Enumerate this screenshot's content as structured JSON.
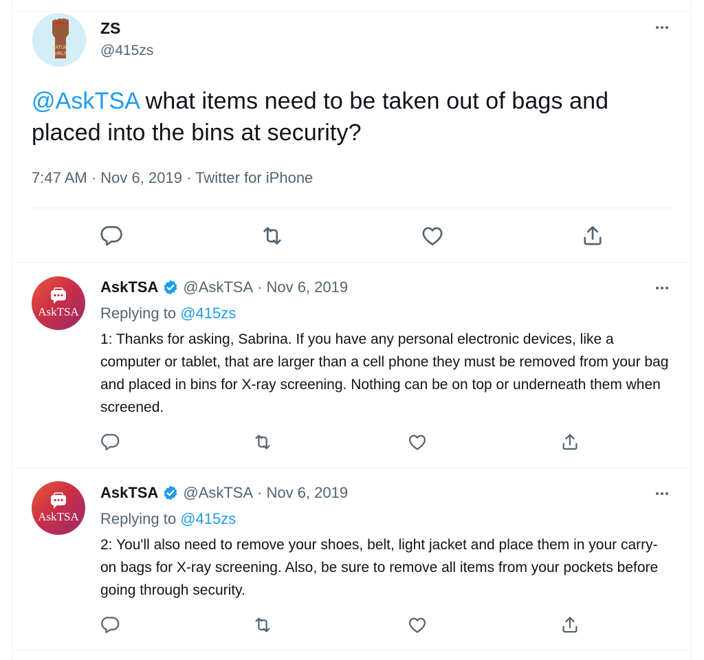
{
  "main_tweet": {
    "display_name": "ZS",
    "handle": "@415zs",
    "mention": "@AskTSA",
    "text": " what items need to be taken out of bags and placed into the bins at security?",
    "time": "7:47 AM",
    "separator": "·",
    "date": "Nov 6, 2019",
    "source": "Twitter for iPhone",
    "avatar_icon": "raised-fist-avatar"
  },
  "replies": [
    {
      "display_name": "AskTSA",
      "verified_icon": "verified-badge-icon",
      "handle": "@AskTSA",
      "separator": "·",
      "date": "Nov 6, 2019",
      "replying_prefix": "Replying to ",
      "replying_to": "@415zs",
      "avatar_label": "AskTSA",
      "text": "1: Thanks for asking, Sabrina. If you have any personal electronic devices, like a computer or tablet, that are larger than a cell phone they must be removed from your bag and placed in bins for X-ray screening. Nothing can be on top or underneath them when screened."
    },
    {
      "display_name": "AskTSA",
      "verified_icon": "verified-badge-icon",
      "handle": "@AskTSA",
      "separator": "·",
      "date": "Nov 6, 2019",
      "replying_prefix": "Replying to ",
      "replying_to": "@415zs",
      "avatar_label": "AskTSA",
      "text": "2: You'll also need to remove your shoes, belt, light jacket and place them in your carry-on bags for X-ray screening. Also, be sure to remove all items from your pockets before going through security."
    }
  ],
  "actions": [
    "reply-icon",
    "retweet-icon",
    "like-icon",
    "share-icon"
  ],
  "colors": {
    "link": "#1d9bf0",
    "muted_text": "#536471",
    "divider": "#eff3f4",
    "icon": "#536471",
    "verified": "#1d9bf0"
  }
}
